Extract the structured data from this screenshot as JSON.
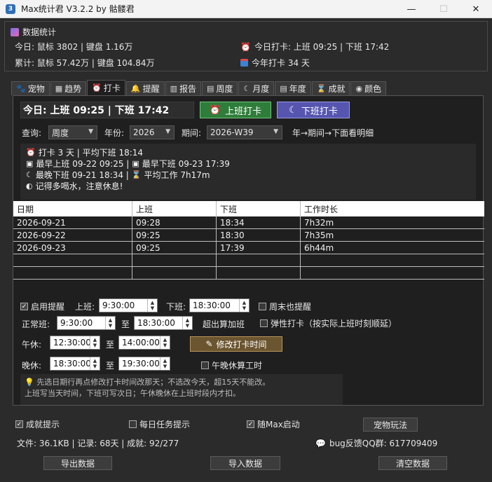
{
  "window": {
    "title": "Max统计君 V3.2.2 by 骷髅君",
    "app_icon": "3",
    "minimize": "—",
    "maximize": "☐",
    "close": "✕"
  },
  "stats": {
    "header": "数据统计",
    "today_line": "今日: 鼠标 3802 | 键盘 1.16万",
    "total_line": "累计: 鼠标 57.42万 | 键盘 104.84万",
    "checkin_line": "今日打卡: 上班 09:25 | 下班 17:42",
    "year_line": "今年打卡 34 天"
  },
  "tabs": [
    {
      "icon": "🐾",
      "label": "宠物"
    },
    {
      "icon": "▦",
      "label": "趋势"
    },
    {
      "icon": "⏰",
      "label": "打卡"
    },
    {
      "icon": "🔔",
      "label": "提醒"
    },
    {
      "icon": "▥",
      "label": "报告"
    },
    {
      "icon": "▤",
      "label": "周度"
    },
    {
      "icon": "☾",
      "label": "月度"
    },
    {
      "icon": "▤",
      "label": "年度"
    },
    {
      "icon": "⌛",
      "label": "成就"
    },
    {
      "icon": "◉",
      "label": "颜色"
    }
  ],
  "checkin": {
    "today_text": "今日: 上班 09:25 | 下班 17:42",
    "on_button": "上班打卡",
    "off_button": "下班打卡",
    "query_label": "查询:",
    "query_value": "周度",
    "year_label": "年份:",
    "year_value": "2026",
    "period_label": "期间:",
    "period_value": "2026-W39",
    "period_hint": "年→期间→下面看明细"
  },
  "summary": [
    {
      "icon": "⏰",
      "text": "打卡 3 天 | 平均下班 18:14"
    },
    {
      "icon": "▣",
      "text": "最早上班 09-22 09:25 | ",
      "icon2": "▣",
      "text2": "最早下班 09-23 17:39"
    },
    {
      "icon": "☾",
      "text": "最晚下班 09-21 18:34 | ",
      "icon2": "⌛",
      "text2": "平均工作 7h17m"
    },
    {
      "icon": "◐",
      "text": "记得多喝水，注意休息!"
    }
  ],
  "table": {
    "headers": [
      "日期",
      "上班",
      "下班",
      "工作时长"
    ],
    "rows": [
      [
        "2026-09-21",
        "09:28",
        "18:34",
        "7h32m"
      ],
      [
        "2026-09-22",
        "09:25",
        "18:30",
        "7h35m"
      ],
      [
        "2026-09-23",
        "09:25",
        "17:39",
        "6h44m"
      ],
      [
        "",
        "",
        "",
        ""
      ],
      [
        "",
        "",
        "",
        ""
      ]
    ]
  },
  "settings": {
    "enable_reminder": "启用提醒",
    "on_label": "上班:",
    "on_value": "9:30:00",
    "off_label": "下班:",
    "off_value": "18:30:00",
    "weekend": "周末也提醒",
    "normal_label": "正常班:",
    "normal_start": "9:30:00",
    "to": "至",
    "normal_end": "18:30:00",
    "overtime": "超出算加班",
    "flex": "弹性打卡（按实际上班时刻顺延）",
    "lunch_label": "午休:",
    "lunch_start": "12:30:00",
    "lunch_end": "14:00:00",
    "edit_button": "修改打卡时间",
    "dinner_label": "晚休:",
    "dinner_start": "18:30:00",
    "dinner_end": "19:30:00",
    "count_breaks": "午晚休算工时",
    "hint1": "先选日期行再点修改打卡时间改那天；不选改今天，超15天不能改。",
    "hint2": "上班写当天时间，下班可写次日；午休晚休在上班时段内才扣。"
  },
  "footer": {
    "achievement_tip": "成就提示",
    "daily_tip": "每日任务提示",
    "autostart": "随Max启动",
    "pet_button": "宠物玩法",
    "file_info": "文件: 36.1KB | 记录: 68天 | 成就: 92/277",
    "qq": "bug反馈QQ群: 617709409",
    "export": "导出数据",
    "import": "导入数据",
    "clear": "清空数据"
  }
}
